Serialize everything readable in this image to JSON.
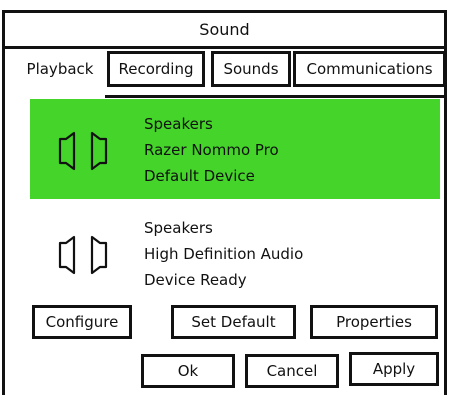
{
  "window": {
    "title": "Sound"
  },
  "tabs": [
    {
      "label": "Playback",
      "active": true
    },
    {
      "label": "Recording",
      "active": false
    },
    {
      "label": "Sounds",
      "active": false
    },
    {
      "label": "Communications",
      "active": false
    }
  ],
  "devices": [
    {
      "name": "Speakers",
      "model": "Razer Nommo Pro",
      "status": "Default Device",
      "icon": "speaker-icon",
      "selected": true
    },
    {
      "name": "Speakers",
      "model": "High Definition Audio",
      "status": "Device Ready",
      "icon": "speaker-icon",
      "selected": false
    }
  ],
  "actions": {
    "configure": "Configure",
    "set_default": "Set Default",
    "properties": "Properties"
  },
  "dialog": {
    "ok": "Ok",
    "cancel": "Cancel",
    "apply": "Apply"
  },
  "colors": {
    "selected_bg": "#44d42a",
    "border": "#111111"
  }
}
